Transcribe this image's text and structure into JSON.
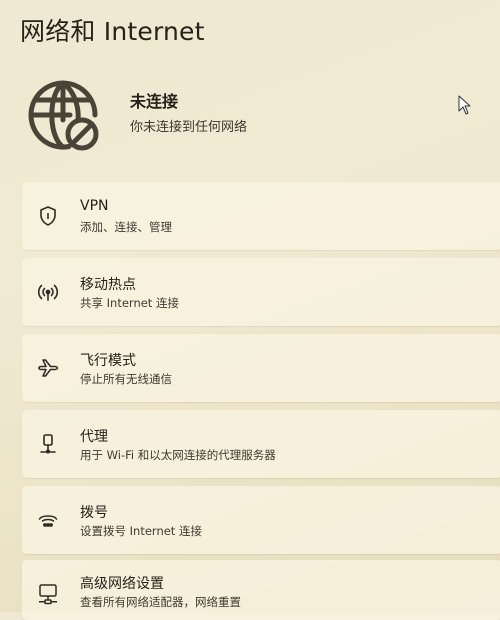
{
  "header": {
    "title": "网络和 Internet"
  },
  "status": {
    "title": "未连接",
    "subtitle": "你未连接到任何网络",
    "icon": "globe-disconnected-icon"
  },
  "items": [
    {
      "title": "VPN",
      "subtitle": "添加、连接、管理",
      "icon": "shield-icon"
    },
    {
      "title": "移动热点",
      "subtitle": "共享 Internet 连接",
      "icon": "hotspot-icon"
    },
    {
      "title": "飞行模式",
      "subtitle": "停止所有无线通信",
      "icon": "airplane-icon"
    },
    {
      "title": "代理",
      "subtitle": "用于 Wi-Fi 和以太网连接的代理服务器",
      "icon": "proxy-icon"
    },
    {
      "title": "拨号",
      "subtitle": "设置拨号 Internet 连接",
      "icon": "dialup-icon"
    },
    {
      "title": "高级网络设置",
      "subtitle": "查看所有网络适配器，网络重置",
      "icon": "network-pc-icon"
    }
  ]
}
